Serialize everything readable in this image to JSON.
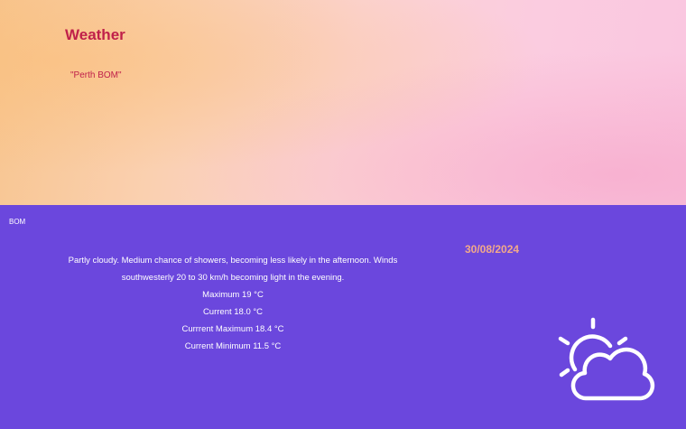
{
  "header": {
    "title": "Weather",
    "subtitle": "\"Perth BOM\""
  },
  "panel": {
    "source": "BOM",
    "date": "30/08/2024",
    "description": "Partly cloudy. Medium chance of showers, becoming less likely in the afternoon. Winds southwesterly 20 to 30 km/h becoming light in the evening.",
    "maximum": "Maximum 19 °C",
    "current": "Current 18.0 °C",
    "current_max": "Currrent Maximum 18.4 °C",
    "current_min": "Current Minimum 11.5 °C"
  },
  "icon": "partly-cloudy-icon",
  "colors": {
    "accent": "#c0204a",
    "panel_bg": "#6b47dd",
    "date": "#f2a98a"
  }
}
